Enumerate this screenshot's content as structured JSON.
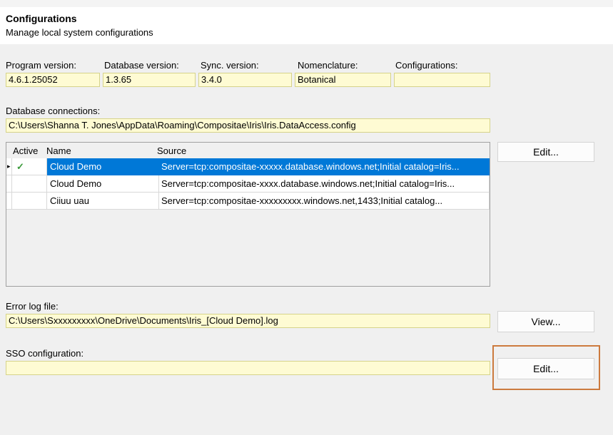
{
  "header": {
    "title": "Configurations",
    "subtitle": "Manage local system configurations"
  },
  "versions": {
    "program_label": "Program version:",
    "program_value": "4.6.1.25052",
    "database_label": "Database version:",
    "database_value": "1.3.65",
    "sync_label": "Sync. version:",
    "sync_value": "3.4.0",
    "nomenclature_label": "Nomenclature:",
    "nomenclature_value": "Botanical",
    "configurations_label": "Configurations:",
    "configurations_value": ""
  },
  "db_connections": {
    "label": "Database connections:",
    "path": "C:\\Users\\Shanna T. Jones\\AppData\\Roaming\\Compositae\\Iris\\Iris.DataAccess.config",
    "edit_label": "Edit...",
    "columns": [
      "Active",
      "Name",
      "Source"
    ],
    "rows": [
      {
        "active": "✓",
        "indicator": "▸",
        "name": "Cloud Demo",
        "source": "Server=tcp:compositae-xxxxx.database.windows.net;Initial catalog=Iris..."
      },
      {
        "active": "",
        "indicator": "",
        "name": "Cloud Demo",
        "source": "Server=tcp:compositae-xxxx.database.windows.net;Initial catalog=Iris..."
      },
      {
        "active": "",
        "indicator": "",
        "name": "Ciiuu uau",
        "source": "Server=tcp:compositae-xxxxxxxxx.windows.net,1433;Initial catalog..."
      }
    ]
  },
  "error_log": {
    "label": "Error log file:",
    "path": "C:\\Users\\Sxxxxxxxxx\\OneDrive\\Documents\\Iris_[Cloud Demo].log",
    "view_label": "View..."
  },
  "sso": {
    "label": "SSO configuration:",
    "value": "",
    "edit_label": "Edit..."
  },
  "colors": {
    "field_bg": "#fefbd3",
    "selection": "#0078d7",
    "highlight": "#cc7a3e",
    "check": "#3a9a3a"
  }
}
